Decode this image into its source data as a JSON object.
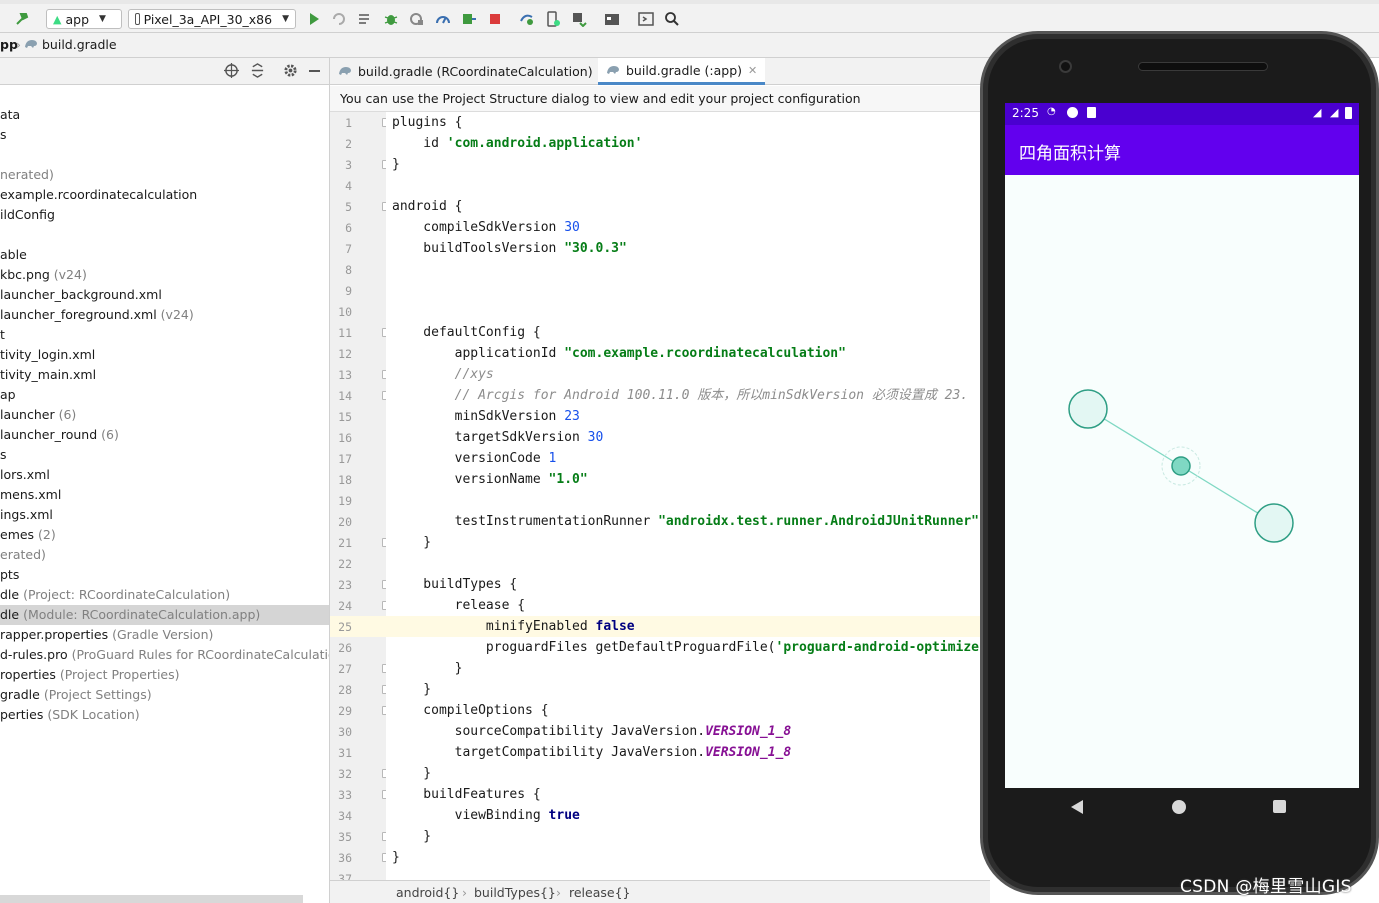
{
  "toolbar": {
    "module_combo": "app",
    "device_combo": "Pixel_3a_API_30_x86"
  },
  "breadcrumb": {
    "root": "pp",
    "file": "build.gradle"
  },
  "project_tree": [
    {
      "text": "ata",
      "hint": ""
    },
    {
      "text": "s",
      "hint": ""
    },
    {
      "text": "",
      "hint": ""
    },
    {
      "text": "",
      "hint": "nerated)"
    },
    {
      "text": "example.rcoordinatecalculation",
      "hint": ""
    },
    {
      "text": "ildConfig",
      "hint": ""
    },
    {
      "text": "",
      "hint": ""
    },
    {
      "text": "able",
      "hint": ""
    },
    {
      "text": "kbc.png",
      "hint": " (v24)"
    },
    {
      "text": "launcher_background.xml",
      "hint": ""
    },
    {
      "text": "launcher_foreground.xml",
      "hint": " (v24)"
    },
    {
      "text": "t",
      "hint": ""
    },
    {
      "text": "tivity_login.xml",
      "hint": ""
    },
    {
      "text": "tivity_main.xml",
      "hint": ""
    },
    {
      "text": "ap",
      "hint": ""
    },
    {
      "text": "launcher",
      "hint": " (6)"
    },
    {
      "text": "launcher_round",
      "hint": " (6)"
    },
    {
      "text": "s",
      "hint": ""
    },
    {
      "text": "lors.xml",
      "hint": ""
    },
    {
      "text": "mens.xml",
      "hint": ""
    },
    {
      "text": "ings.xml",
      "hint": ""
    },
    {
      "text": "emes",
      "hint": " (2)"
    },
    {
      "text": "",
      "hint": "erated)"
    },
    {
      "text": "pts",
      "hint": ""
    },
    {
      "text": "dle",
      "hint": " (Project: RCoordinateCalculation)"
    },
    {
      "text": "dle",
      "hint": " (Module: RCoordinateCalculation.app)"
    },
    {
      "text": "rapper.properties",
      "hint": " (Gradle Version)"
    },
    {
      "text": "d-rules.pro",
      "hint": " (ProGuard Rules for RCoordinateCalculation.a"
    },
    {
      "text": "roperties",
      "hint": " (Project Properties)"
    },
    {
      "text": "gradle",
      "hint": " (Project Settings)"
    },
    {
      "text": "perties",
      "hint": " (SDK Location)"
    }
  ],
  "tabs": [
    {
      "label": "build.gradle (RCoordinateCalculation)"
    },
    {
      "label": "build.gradle (:app)"
    }
  ],
  "notice": "You can use the Project Structure dialog to view and edit your project configuration",
  "line_numbers": [
    "1",
    "2",
    "3",
    "4",
    "5",
    "6",
    "7",
    "8",
    "9",
    "10",
    "11",
    "12",
    "13",
    "14",
    "15",
    "16",
    "17",
    "18",
    "19",
    "20",
    "21",
    "22",
    "23",
    "24",
    "25",
    "26",
    "27",
    "28",
    "29",
    "30",
    "31",
    "32",
    "33",
    "34",
    "35",
    "36",
    "37"
  ],
  "code": {
    "l1": "plugins {",
    "l2a": "    id ",
    "l2s": "'com.android.application'",
    "l3": "}",
    "l5": "android {",
    "l6a": "    compileSdkVersion ",
    "l6n": "30",
    "l7a": "    buildToolsVersion ",
    "l7s": "\"30.0.3\"",
    "l11": "    defaultConfig {",
    "l12a": "        applicationId ",
    "l12s": "\"com.example.rcoordinatecalculation\"",
    "l13c": "        //xys",
    "l14c": "        // Arcgis for Android 100.11.0 版本，所以minSdkVersion 必须设置成 23.",
    "l15a": "        minSdkVersion ",
    "l15n": "23",
    "l16a": "        targetSdkVersion ",
    "l16n": "30",
    "l17a": "        versionCode ",
    "l17n": "1",
    "l18a": "        versionName ",
    "l18s": "\"1.0\"",
    "l20a": "        testInstrumentationRunner ",
    "l20s": "\"androidx.test.runner.AndroidJUnitRunner\"",
    "l21": "    }",
    "l23": "    buildTypes {",
    "l24": "        release {",
    "l25a": "            minifyEnabled ",
    "l25k": "false",
    "l26a": "            proguardFiles getDefaultProguardFile(",
    "l26s": "'proguard-android-optimize.txt'",
    "l27": "        }",
    "l28": "    }",
    "l29": "    compileOptions {",
    "l30a": "        sourceCompatibility JavaVersion.",
    "l30v": "VERSION_1_8",
    "l31a": "        targetCompatibility JavaVersion.",
    "l31v": "VERSION_1_8",
    "l32": "    }",
    "l33": "    buildFeatures {",
    "l34a": "        viewBinding ",
    "l34k": "true",
    "l35": "    }",
    "l36": "}"
  },
  "status_crumbs": [
    "android{}",
    "buildTypes{}",
    "release{}"
  ],
  "emulator": {
    "time": "2:25",
    "app_title": "四角面积计算",
    "colors": {
      "app_bar": "#6200ee",
      "status_bar": "#4a00d0",
      "node_fill": "#e3f7f3",
      "node_stroke": "#2e9e84",
      "center_fill": "#7fd8c3"
    }
  },
  "watermark": "CSDN @梅里雪山GIS"
}
